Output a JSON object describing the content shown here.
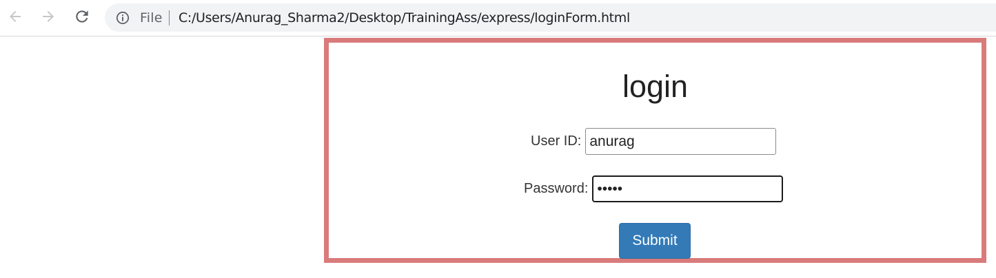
{
  "browser": {
    "scheme_label": "File",
    "url": "C:/Users/Anurag_Sharma2/Desktop/TrainingAss/express/loginForm.html",
    "icons": {
      "back": "arrow-left-icon",
      "forward": "arrow-right-icon",
      "reload": "reload-icon",
      "info": "info-icon"
    }
  },
  "page": {
    "title": "login",
    "user_id": {
      "label": "User ID:",
      "value": "anurag"
    },
    "password": {
      "label": "Password:",
      "value": "•••••"
    },
    "submit_label": "Submit"
  },
  "colors": {
    "frame_border": "#d97b7b",
    "button_bg": "#337ab7",
    "omnibox_bg": "#f1f3f4"
  }
}
